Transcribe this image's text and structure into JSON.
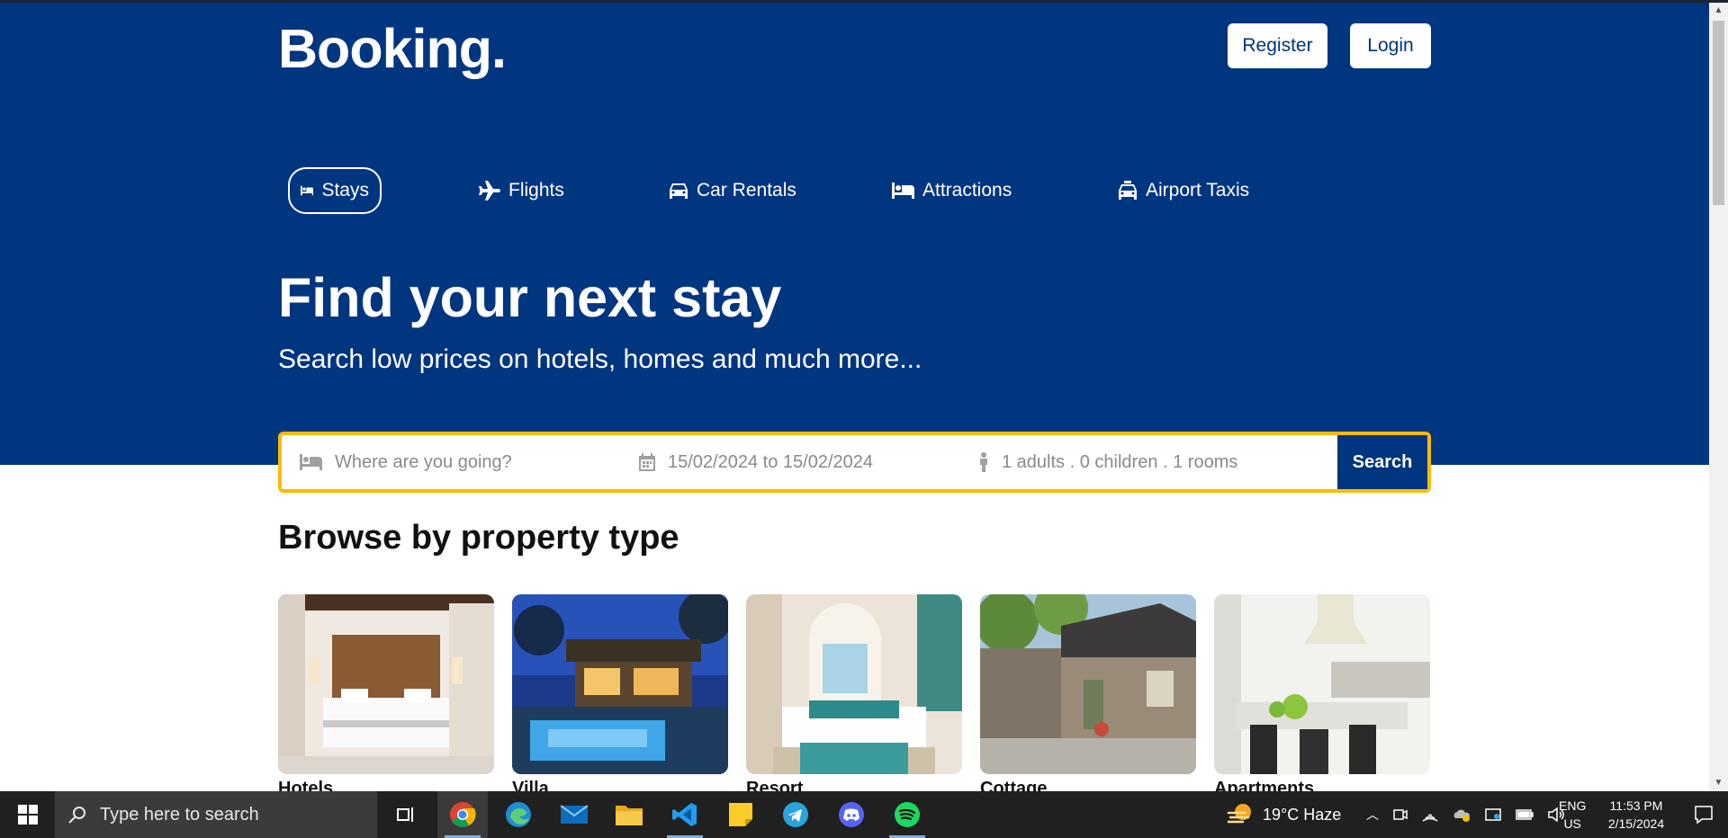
{
  "header": {
    "logo": "Booking.",
    "register": "Register",
    "login": "Login"
  },
  "nav": [
    {
      "label": "Stays",
      "icon": "bed-icon",
      "active": true
    },
    {
      "label": "Flights",
      "icon": "plane-icon",
      "active": false
    },
    {
      "label": "Car Rentals",
      "icon": "car-icon",
      "active": false
    },
    {
      "label": "Attractions",
      "icon": "bed-icon",
      "active": false
    },
    {
      "label": "Airport Taxis",
      "icon": "taxi-icon",
      "active": false
    }
  ],
  "hero": {
    "title": "Find your next stay",
    "subtitle": "Search low prices on hotels, homes and much more..."
  },
  "search": {
    "destination_placeholder": "Where are you going?",
    "dates": "15/02/2024 to 15/02/2024",
    "guests": "1 adults . 0 children . 1 rooms",
    "button": "Search"
  },
  "browse": {
    "title": "Browse by property type",
    "items": [
      {
        "name": "Hotels"
      },
      {
        "name": "Villa"
      },
      {
        "name": "Resort"
      },
      {
        "name": "Cottage"
      },
      {
        "name": "Apartments"
      }
    ]
  },
  "taskbar": {
    "search_placeholder": "Type here to search",
    "weather": "19°C  Haze",
    "lang": "ENG",
    "region": "US",
    "time": "11:53 PM",
    "date": "2/15/2024"
  },
  "colors": {
    "brand": "#003580",
    "accent": "#febb02"
  }
}
